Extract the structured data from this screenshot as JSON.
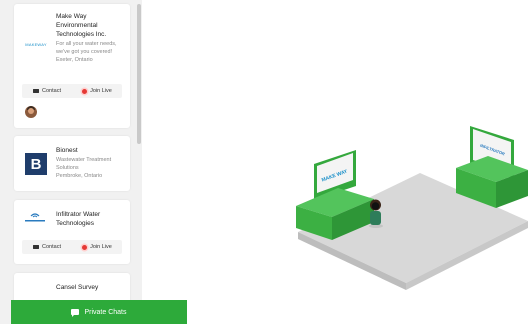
{
  "sidebar": {
    "exhibitors": [
      {
        "name": "Make Way Environmental Technologies Inc.",
        "description": "For all your water needs, we've got you covered!",
        "location": "Exeter, Ontario",
        "logo_text": "MAKEWAY",
        "actions": {
          "contact": "Contact",
          "join_live": "Join Live"
        }
      },
      {
        "name": "Bionest",
        "description": "Wastewater Treatment Solutions",
        "location": "Pembroke, Ontario",
        "logo_text": "B"
      },
      {
        "name": "Infiltrator Water Technologies",
        "actions": {
          "contact": "Contact",
          "join_live": "Join Live"
        }
      },
      {
        "name": "Cansel Survey"
      }
    ]
  },
  "footer": {
    "private_chats_label": "Private Chats"
  },
  "booths": [
    {
      "sign_text": "MAKE WAY"
    },
    {
      "sign_text": "INFILTRATOR"
    }
  ],
  "colors": {
    "accent_green": "#2daa3a",
    "booth_green": "#3cb043",
    "live_red": "#e53935"
  },
  "icons": [
    "mail-icon",
    "live-dot-icon",
    "chat-icon"
  ]
}
